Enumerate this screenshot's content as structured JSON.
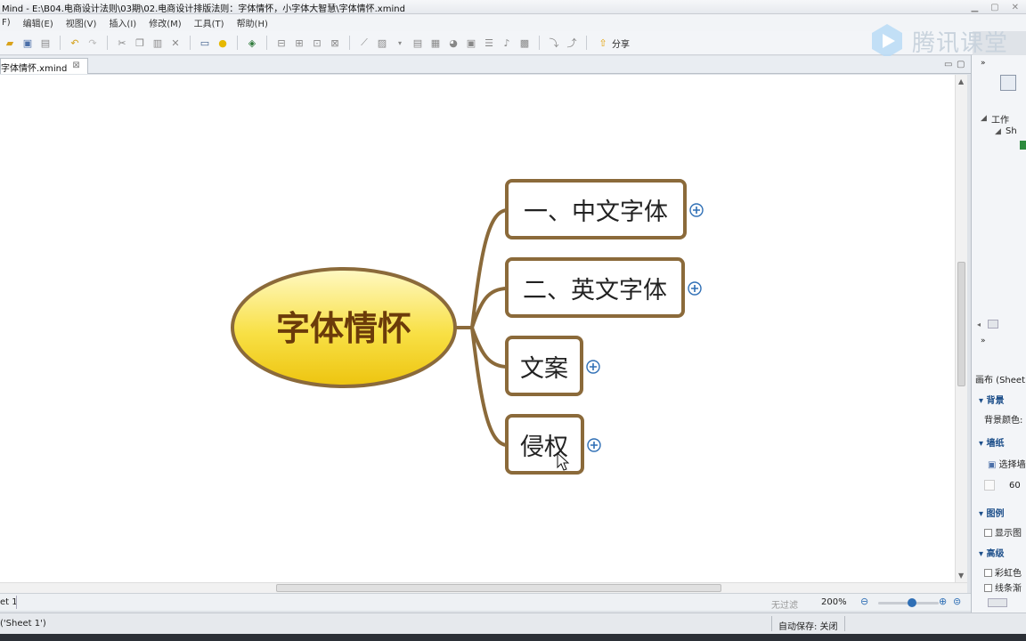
{
  "window": {
    "title": "Mind - E:\\B04.电商设计法则\\03期\\02.电商设计排版法则：字体情怀，小字体大智慧\\字体情怀.xmind"
  },
  "menu": {
    "items": [
      "F)",
      "编辑(E)",
      "视图(V)",
      "插入(I)",
      "修改(M)",
      "工具(T)",
      "帮助(H)"
    ]
  },
  "toolbar": {
    "share_label": "分享"
  },
  "brand": {
    "text": "腾讯课堂"
  },
  "editor": {
    "tab_label": "字体情怀.xmind"
  },
  "mindmap": {
    "central": "字体情怀",
    "topics": [
      "一、中文字体",
      "二、英文字体",
      "文案",
      "侵权"
    ]
  },
  "status": {
    "sheet_tab": "et 1",
    "filter_label": "无过滤",
    "zoom": "200%",
    "selection": "('Sheet 1')",
    "autosave": "自动保存: 关闭"
  },
  "right_panel": {
    "tree_root": "工作",
    "tree_sheet": "Sh",
    "canvas_header": "画布 (Sheet 1",
    "section_background": "背景",
    "bg_color_label": "背景颜色:",
    "section_wallpaper": "墙纸",
    "select_wallpaper": "选择墙",
    "opacity_value": "60",
    "section_legend": "图例",
    "show_legend": "显示图",
    "section_advanced": "高级",
    "rainbow": "彩虹色",
    "line_gradient": "线条渐"
  },
  "colors": {
    "topic_border": "#8b6a3a",
    "central_fill_top": "#fff7b0",
    "central_fill_bottom": "#f2cf15",
    "central_text": "#6b3b0a",
    "accent_blue": "#2f6fb5"
  }
}
